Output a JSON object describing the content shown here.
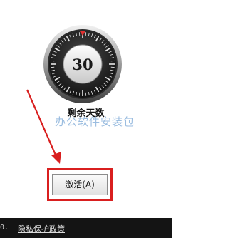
{
  "countdown": {
    "remaining_days": "30",
    "label": "剩余天数"
  },
  "watermark": "办公软件安装包",
  "activate_button_label": "激活(A)",
  "footer": {
    "prefix_text": "0.",
    "privacy_link": "隐私保护政策"
  },
  "colors": {
    "highlight_red": "#d91f1f",
    "footer_bg": "#141414"
  }
}
